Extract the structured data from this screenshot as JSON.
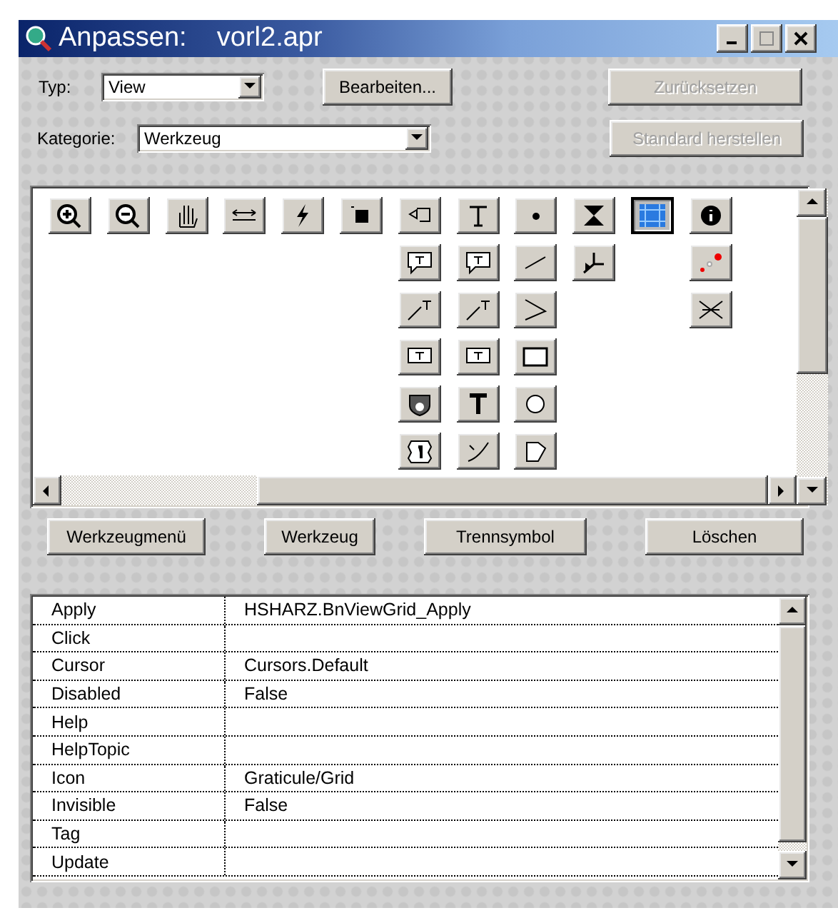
{
  "window": {
    "title": "Anpassen:    vorl2.apr"
  },
  "typ": {
    "label": "Typ:",
    "value": "View"
  },
  "edit_button": {
    "label": "Bearbeiten...",
    "disabled": false
  },
  "reset_button": {
    "label": "Zurücksetzen",
    "disabled": true
  },
  "kategorie": {
    "label": "Kategorie:",
    "value": "Werkzeug"
  },
  "default_button": {
    "label": "Standard herstellen",
    "disabled": true
  },
  "tool_columns": [
    {
      "tools": [
        {
          "kind": "zoomin",
          "selected": false
        }
      ]
    },
    {
      "tools": [
        {
          "kind": "zoomout",
          "selected": false
        }
      ]
    },
    {
      "tools": [
        {
          "kind": "pan",
          "selected": false
        }
      ]
    },
    {
      "tools": [
        {
          "kind": "measure",
          "selected": false
        }
      ]
    },
    {
      "tools": [
        {
          "kind": "hotlink",
          "selected": false
        }
      ]
    },
    {
      "tools": [
        {
          "kind": "select",
          "selected": false
        }
      ]
    },
    {
      "tools": [
        {
          "kind": "pointer",
          "selected": false
        },
        {
          "kind": "callout",
          "selected": false
        },
        {
          "kind": "leader",
          "selected": false
        },
        {
          "kind": "label",
          "selected": false
        },
        {
          "kind": "shield",
          "selected": false
        },
        {
          "kind": "badge",
          "selected": false
        }
      ]
    },
    {
      "tools": [
        {
          "kind": "text",
          "selected": false
        },
        {
          "kind": "callout",
          "selected": false
        },
        {
          "kind": "leader",
          "selected": false
        },
        {
          "kind": "label",
          "selected": false
        },
        {
          "kind": "boldtext",
          "selected": false
        },
        {
          "kind": "curve",
          "selected": false
        }
      ]
    },
    {
      "tools": [
        {
          "kind": "point",
          "selected": false
        },
        {
          "kind": "line",
          "selected": false
        },
        {
          "kind": "polyline",
          "selected": false
        },
        {
          "kind": "rectangle",
          "selected": false
        },
        {
          "kind": "circle",
          "selected": false
        },
        {
          "kind": "polygon",
          "selected": false
        }
      ]
    },
    {
      "tools": [
        {
          "kind": "hourglass",
          "selected": false
        },
        {
          "kind": "snap",
          "selected": false
        }
      ]
    },
    {
      "tools": [
        {
          "kind": "grid",
          "selected": true
        }
      ]
    },
    {
      "tools": [
        {
          "kind": "info",
          "selected": false
        },
        {
          "kind": "dots",
          "selected": false
        },
        {
          "kind": "cross",
          "selected": false
        }
      ]
    }
  ],
  "action_buttons": [
    "Werkzeugmenü",
    "Werkzeug",
    "Trennsymbol",
    "Löschen"
  ],
  "properties": [
    {
      "name": "Apply",
      "value": "HSHARZ.BnViewGrid_Apply"
    },
    {
      "name": "Click"
    },
    {
      "name": "Cursor",
      "value": "Cursors.Default"
    },
    {
      "name": "Disabled",
      "value": "False"
    },
    {
      "name": "Help"
    },
    {
      "name": "HelpTopic"
    },
    {
      "name": "Icon",
      "value": "Graticule/Grid"
    },
    {
      "name": "Invisible",
      "value": "False"
    },
    {
      "name": "Tag"
    },
    {
      "name": "Update"
    }
  ]
}
